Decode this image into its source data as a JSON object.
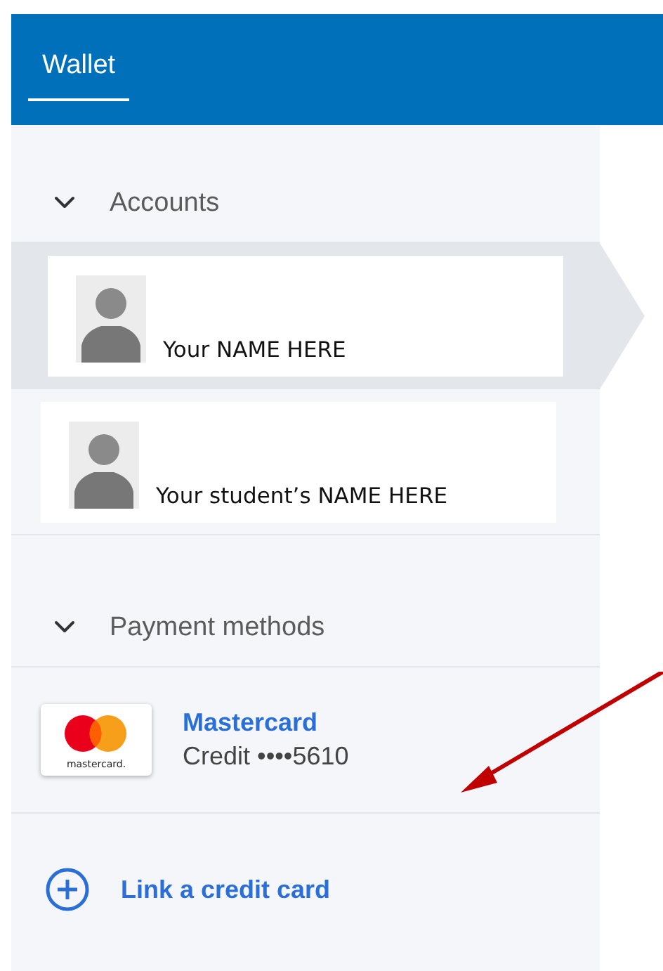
{
  "header": {
    "title": "Wallet",
    "selected": true
  },
  "sections": [
    {
      "kind": "accounts",
      "title": "Accounts",
      "expanded": true,
      "items": [
        {
          "name": "Your NAME HERE",
          "selected": true
        },
        {
          "name": "Your student’s NAME HERE",
          "selected": false
        }
      ]
    },
    {
      "kind": "payments",
      "title": "Payment methods",
      "expanded": true,
      "items": [
        {
          "brand": "Mastercard",
          "detail": "Credit ••••5610",
          "logo_text": "mastercard."
        }
      ]
    }
  ],
  "link_action": {
    "label": "Link a credit card"
  },
  "annotation": {
    "kind": "arrow"
  }
}
